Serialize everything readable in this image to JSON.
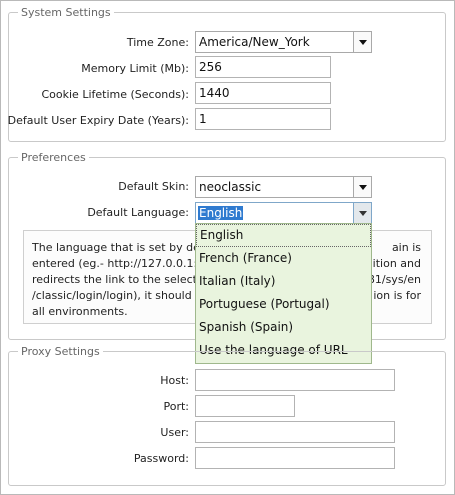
{
  "system_settings": {
    "legend": "System Settings",
    "time_zone_label": "Time Zone:",
    "time_zone_value": "America/New_York",
    "memory_limit_label": "Memory Limit (Mb):",
    "memory_limit_value": "256",
    "cookie_lifetime_label": "Cookie Lifetime (Seconds):",
    "cookie_lifetime_value": "1440",
    "expiry_label": "Default User Expiry Date (Years):",
    "expiry_value": "1"
  },
  "preferences": {
    "legend": "Preferences",
    "skin_label": "Default Skin:",
    "skin_value": "neoclassic",
    "language_label": "Default Language:",
    "language_value": "English",
    "note_lines": [
      "The language that is set by defa",
      "entered (eg.- http://127.0.0.1:80",
      "redirects the link to the selecte",
      "/classic/login/login), it should b",
      "all environments."
    ],
    "note_tails": [
      "ain is",
      "ition and",
      "81/sys/en",
      "ion is for",
      ""
    ],
    "language_options": [
      "English",
      "French (France)",
      "Italian (Italy)",
      "Portuguese (Portugal)",
      "Spanish (Spain)",
      "Use the language of URL"
    ]
  },
  "proxy_settings": {
    "legend": "Proxy Settings",
    "host_label": "Host:",
    "host_value": "",
    "port_label": "Port:",
    "port_value": "",
    "user_label": "User:",
    "user_value": "",
    "password_label": "Password:",
    "password_value": ""
  },
  "colors": {
    "dropdown_bg": "#e9f4de",
    "selection_highlight": "#2f7bd0"
  }
}
